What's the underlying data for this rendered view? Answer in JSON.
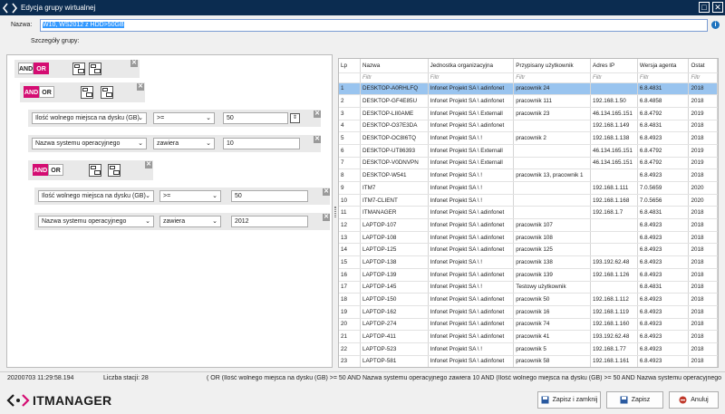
{
  "window": {
    "title": "Edycja grupy wirtualnej"
  },
  "name_field": {
    "label": "Nazwa:",
    "value": "W10, WS2012 z HDD>50GB"
  },
  "details_label": "Szczegóły grupy:",
  "logic": {
    "and": "AND",
    "or": "OR"
  },
  "conditions": [
    {
      "field": "Ilość wolnego miejsca na dysku (GB)",
      "op": ">=",
      "value": "50"
    },
    {
      "field": "Nazwa systemu operacyjnego",
      "op": "zawiera",
      "value": "10"
    },
    {
      "field": "Ilość wolnego miejsca na dysku (GB)",
      "op": ">=",
      "value": "50"
    },
    {
      "field": "Nazwa systemu operacyjnego",
      "op": "zawiera",
      "value": "2012"
    }
  ],
  "table": {
    "headers": [
      "Lp",
      "Nazwa",
      "Jednostka organizacyjna",
      "Przypisany użytkownik",
      "Adres IP",
      "Wersja agenta",
      "Ostat"
    ],
    "filter_placeholder": "Filtr",
    "rows": [
      [
        "1",
        "DESKTOP-A0RHLFQ",
        "Infonet Projekt SA \\ adinfonet",
        "pracownik 24",
        "",
        "6.8.4831",
        "2018"
      ],
      [
        "2",
        "DESKTOP-GF4E85U",
        "Infonet Projekt SA \\ adinfonet",
        "pracownik 111",
        "192.168.1.50",
        "6.8.4858",
        "2018"
      ],
      [
        "3",
        "DESKTOP-LII0AME",
        "Infonet Projekt SA \\ Externall",
        "pracownik 23",
        "46.134.165.151",
        "6.8.4792",
        "2019"
      ],
      [
        "4",
        "DESKTOP-O37E3DA",
        "Infonet Projekt SA \\ adinfonet",
        "",
        "192.168.1.149",
        "6.8.4831",
        "2018"
      ],
      [
        "5",
        "DESKTOP-OC8I6TQ",
        "Infonet Projekt SA \\ !",
        "pracownik 2",
        "192.168.1.138",
        "6.8.4923",
        "2018"
      ],
      [
        "6",
        "DESKTOP-UT86393",
        "Infonet Projekt SA \\ Externall",
        "",
        "46.134.165.151",
        "6.8.4792",
        "2019"
      ],
      [
        "7",
        "DESKTOP-V0DNVPN",
        "Infonet Projekt SA \\ Externall",
        "",
        "46.134.165.151",
        "6.8.4792",
        "2019"
      ],
      [
        "8",
        "DESKTOP-W541",
        "Infonet Projekt SA \\ !",
        "pracownik 13, pracownik 1",
        "",
        "6.8.4923",
        "2018"
      ],
      [
        "9",
        "ITM7",
        "Infonet Projekt SA \\ !",
        "",
        "192.168.1.111",
        "7.0.5659",
        "2020"
      ],
      [
        "10",
        "ITM7-CLIENT",
        "Infonet Projekt SA \\ !",
        "",
        "192.168.1.168",
        "7.0.5656",
        "2020"
      ],
      [
        "11",
        "ITMANAGER",
        "Infonet Projekt SA \\ adinfonet",
        "",
        "192.168.1.7",
        "6.8.4831",
        "2018"
      ],
      [
        "12",
        "LAPTOP-107",
        "Infonet Projekt SA \\ adinfonet",
        "pracownik 107",
        "",
        "6.8.4923",
        "2018"
      ],
      [
        "13",
        "LAPTOP-108",
        "Infonet Projekt SA \\ adinfonet",
        "pracownik 108",
        "",
        "6.8.4923",
        "2018"
      ],
      [
        "14",
        "LAPTOP-125",
        "Infonet Projekt SA \\ adinfonet",
        "pracownik 125",
        "",
        "6.8.4923",
        "2018"
      ],
      [
        "15",
        "LAPTOP-138",
        "Infonet Projekt SA \\ !",
        "pracownik 138",
        "193.192.62.48",
        "6.8.4923",
        "2018"
      ],
      [
        "16",
        "LAPTOP-139",
        "Infonet Projekt SA \\ adinfonet",
        "pracownik 139",
        "192.168.1.126",
        "6.8.4923",
        "2018"
      ],
      [
        "17",
        "LAPTOP-145",
        "Infonet Projekt SA \\ !",
        "Testowy użytkownik",
        "",
        "6.8.4831",
        "2018"
      ],
      [
        "18",
        "LAPTOP-150",
        "Infonet Projekt SA \\ adinfonet",
        "pracownik 50",
        "192.168.1.112",
        "6.8.4923",
        "2018"
      ],
      [
        "19",
        "LAPTOP-162",
        "Infonet Projekt SA \\ adinfonet",
        "pracownik 16",
        "192.168.1.119",
        "6.8.4923",
        "2018"
      ],
      [
        "20",
        "LAPTOP-274",
        "Infonet Projekt SA \\ adinfonet",
        "pracownik 74",
        "192.168.1.160",
        "6.8.4923",
        "2018"
      ],
      [
        "21",
        "LAPTOP-411",
        "Infonet Projekt SA \\ adinfonet",
        "pracownik 41",
        "193.192.62.48",
        "6.8.4923",
        "2018"
      ],
      [
        "22",
        "LAPTOP-523",
        "Infonet Projekt SA \\ !",
        "pracownik 5",
        "192.168.1.77",
        "6.8.4923",
        "2018"
      ],
      [
        "23",
        "LAPTOP-581",
        "Infonet Projekt SA \\ adinfonet",
        "pracownik 58",
        "192.168.1.161",
        "6.8.4923",
        "2018"
      ]
    ]
  },
  "status": {
    "timestamp": "20200703 11:29:58.194",
    "station_count": "Liczba stacji: 28",
    "expression": "( OR (Ilość wolnego miejsca na dysku (GB) >= 50 AND Nazwa systemu operacyjnego zawiera 10  AND (Ilość wolnego miejsca na dysku (GB) >= 50 AND Nazwa systemu operacyjnego"
  },
  "brand": {
    "name": "ITMANAGER"
  },
  "buttons": {
    "save_close": "Zapisz i zamknij",
    "save": "Zapisz",
    "cancel": "Anuluj"
  },
  "colors": {
    "accent": "#d40d72",
    "titlebar": "#0b2c50",
    "selected_row": "#99c4ef"
  }
}
